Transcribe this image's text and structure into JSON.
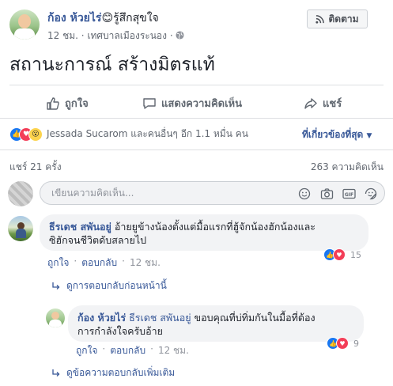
{
  "post": {
    "author": "ก้อง ห้วยไร่",
    "feeling": "รู้สึกสุขใจ",
    "time": "12 ชม.",
    "location": "เทศบาลเมืองระนอง",
    "follow_label": "ติดตาม",
    "text": "สถานะการณ์ สร้างมิตรแท้"
  },
  "actions": {
    "like": "ถูกใจ",
    "comment": "แสดงความคิดเห็น",
    "share": "แชร์"
  },
  "reactions": {
    "summary": "Jessada Sucarom และคนอื่นๆ อีก 1.1 หมื่น คน",
    "sort": "ที่เกี่ยวข้องที่สุด",
    "shares": "แชร์ 21 ครั้ง",
    "comments": "263 ความคิดเห็น"
  },
  "comment_box": {
    "placeholder": "เขียนความคิดเห็น..."
  },
  "comments": [
    {
      "name": "ธีรเดช สพันอยู่",
      "text_line1": "อ้ายยูข้างน้องตั้งแต่มื้อแรกที่ฮู้จักน้องฮักน้องและ",
      "text_line2": "ซิฮักจนชีวิตดับสลายไป",
      "like": "ถูกใจ",
      "reply": "ตอบกลับ",
      "time": "12 ชม.",
      "reaction_count": "15",
      "prev_replies": "ดูการตอบกลับก่อนหน้านี้"
    }
  ],
  "reply": {
    "name": "ก้อง ห้วยไร่",
    "mention": "ธีรเดช สพันอยู่",
    "text_line1": "ขอบคุณที่บ่ทิ่มกันในมื้อที่ต้อง",
    "text_line2": "การกำลังใจครับอ้าย",
    "like": "ถูกใจ",
    "reply": "ตอบกลับ",
    "time": "12 ชม.",
    "reaction_count": "9",
    "more_replies": "ดูข้อความตอบกลับเพิ่มเติม"
  },
  "colors": {
    "link": "#385898",
    "like_blue": "#1877f2",
    "love_red": "#f33e58"
  }
}
